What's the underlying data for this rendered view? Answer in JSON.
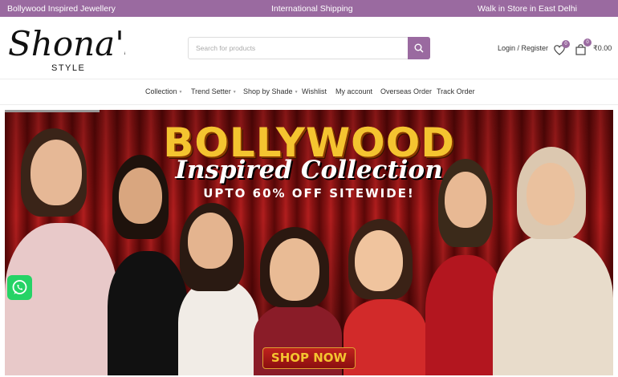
{
  "topbar": {
    "left": "Bollywood Inspired Jewellery",
    "center": "International Shipping",
    "right": "Walk in Store in East Delhi",
    "bg_color": "#9a6aa0"
  },
  "header": {
    "logo_script": "Shona's",
    "logo_sub": "STYLE",
    "search_placeholder": "Search for products",
    "search_icon": "search-icon",
    "login_label": "Login / Register",
    "wishlist_count": "0",
    "cart_count": "0",
    "cart_total": "₹0.00"
  },
  "nav": {
    "items": [
      {
        "label": "Collection",
        "has_dropdown": true
      },
      {
        "label": "Trend Setter",
        "has_dropdown": true
      },
      {
        "label": "Shop by Shade",
        "has_dropdown": true
      },
      {
        "label": "Wishlist",
        "has_dropdown": false
      },
      {
        "label": "My account",
        "has_dropdown": false
      },
      {
        "label": "Overseas Order",
        "has_dropdown": false
      },
      {
        "label": "Track Order",
        "has_dropdown": false
      }
    ]
  },
  "hero": {
    "title": "BOLLYWOOD",
    "subtitle": "Inspired Collection",
    "offer": "UPTO 60% OFF SITEWIDE!",
    "cta": "SHOP NOW",
    "accent_color": "#f4c430",
    "curtain_color": "#8f1414"
  },
  "floating": {
    "whatsapp_icon": "whatsapp-icon"
  }
}
